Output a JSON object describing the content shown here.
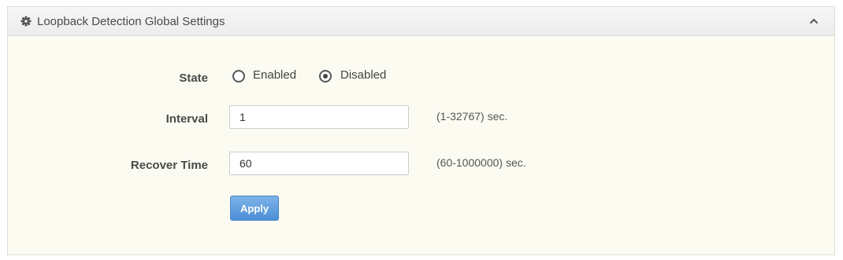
{
  "panel": {
    "title": "Loopback Detection Global Settings",
    "header_icon": "gear-icon",
    "collapse_icon": "chevron-up-icon"
  },
  "form": {
    "state": {
      "label": "State",
      "options": [
        {
          "label": "Enabled",
          "checked": false
        },
        {
          "label": "Disabled",
          "checked": true
        }
      ]
    },
    "interval": {
      "label": "Interval",
      "value": "1",
      "hint": "(1-32767) sec."
    },
    "recover_time": {
      "label": "Recover Time",
      "value": "60",
      "hint": "(60-1000000) sec."
    }
  },
  "apply_label": "Apply",
  "colors": {
    "panel_background": "#fbfbf1",
    "apply_button": "#5b9be0"
  }
}
